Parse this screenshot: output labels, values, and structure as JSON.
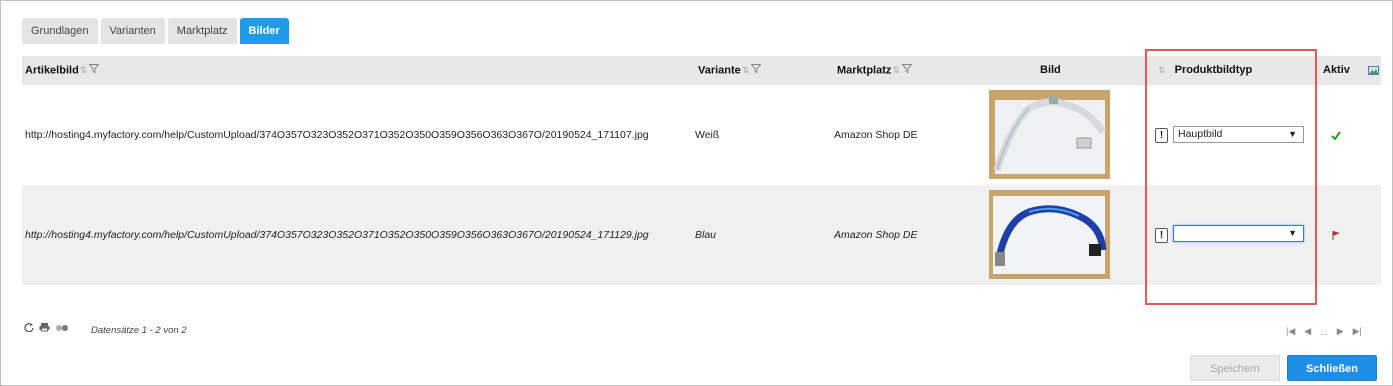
{
  "tabs": [
    {
      "label": "Grundlagen",
      "active": false
    },
    {
      "label": "Varianten",
      "active": false
    },
    {
      "label": "Marktplatz",
      "active": false
    },
    {
      "label": "Bilder",
      "active": true
    }
  ],
  "grid": {
    "headers": {
      "artikelbild": "Artikelbild",
      "variante": "Variante",
      "marktplatz": "Marktplatz",
      "bild": "Bild",
      "produktbildtyp": "Produktbildtyp",
      "aktiv": "Aktiv"
    },
    "rows": [
      {
        "url": "http://hosting4.myfactory.com/help/CustomUpload/374O357O323O352O371O352O350O359O356O363O367O/20190524_171107.jpg",
        "variante": "Weiß",
        "marktplatz": "Amazon Shop DE",
        "bild_icon": "lanyard-white-photo",
        "produktbildtyp": "Hauptbild",
        "excl": "!",
        "aktiv_icon": "check-icon"
      },
      {
        "url": "http://hosting4.myfactory.com/help/CustomUpload/374O357O323O352O371O352O350O359O356O363O367O/20190524_171129.jpg",
        "variante": "Blau",
        "marktplatz": "Amazon Shop DE",
        "bild_icon": "lanyard-blue-photo",
        "produktbildtyp": "",
        "excl": "!",
        "aktiv_icon": "flag-icon"
      }
    ]
  },
  "footer": {
    "records": "Datensätze 1 - 2 von 2",
    "pager_dots": "..."
  },
  "buttons": {
    "save": "Speichern",
    "close": "Schließen"
  },
  "colors": {
    "accent": "#1e9be9",
    "highlight_box": "#e45a5a",
    "check": "#2a9a2a",
    "flag": "#c0302a"
  }
}
